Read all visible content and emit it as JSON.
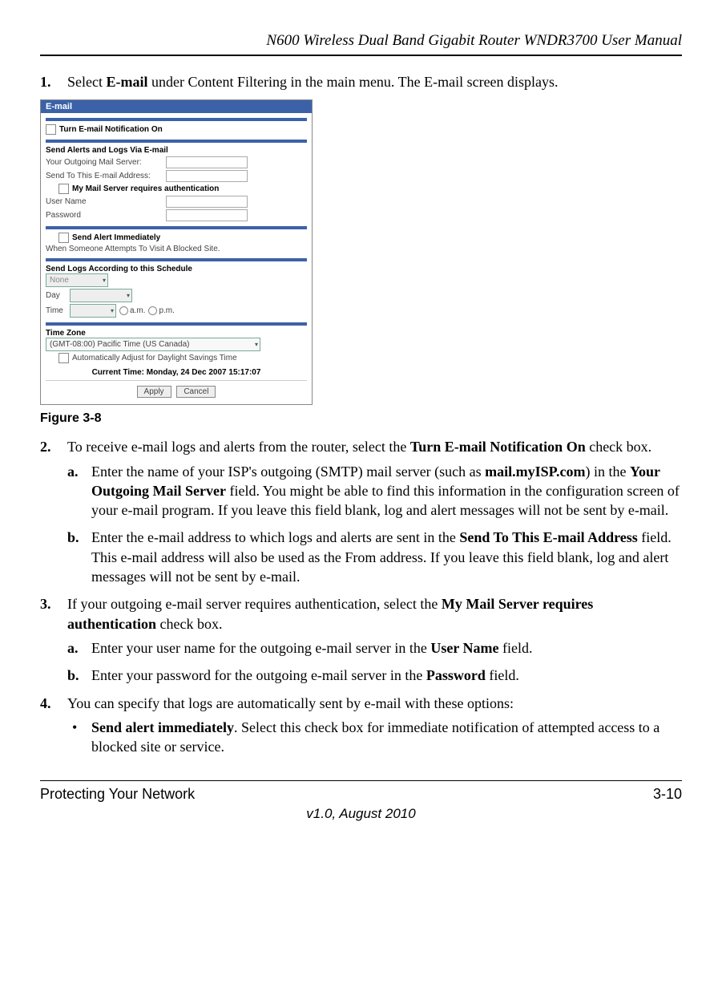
{
  "header": {
    "title": "N600 Wireless Dual Band Gigabit Router WNDR3700 User Manual"
  },
  "steps": {
    "s1": {
      "num": "1.",
      "pre": "Select ",
      "b1": "E-mail",
      "post": " under Content Filtering in the main menu. The E-mail screen displays."
    },
    "fig_caption": "Figure 3-8",
    "s2": {
      "num": "2.",
      "pre": "To receive e-mail logs and alerts from the router, select the ",
      "b1": "Turn E-mail Notification On",
      "post": " check box.",
      "a": {
        "num": "a.",
        "t1": "Enter the name of your ISP's outgoing (SMTP) mail server (such as ",
        "b1": "mail.myISP.com",
        "t2": ") in the ",
        "b2": "Your Outgoing Mail Server",
        "t3": " field. You might be able to find this information in the configuration screen of your e-mail program. If you leave this field blank, log and alert messages will not be sent by e-mail."
      },
      "b": {
        "num": "b.",
        "t1": "Enter the e-mail address to which logs and alerts are sent in the ",
        "b1": "Send To This E-mail Address",
        "t2": " field. This e-mail address will also be used as the From address. If you leave this field blank, log and alert messages will not be sent by e-mail."
      }
    },
    "s3": {
      "num": "3.",
      "t1": "If your outgoing e-mail server requires authentication, select the ",
      "b1": "My Mail Server requires authentication",
      "t2": " check box.",
      "a": {
        "num": "a.",
        "t1": "Enter your user name for the outgoing e-mail server in the ",
        "b1": "User Name",
        "t2": " field."
      },
      "b": {
        "num": "b.",
        "t1": "Enter your password for the outgoing e-mail server in the ",
        "b1": "Password",
        "t2": " field."
      }
    },
    "s4": {
      "num": "4.",
      "text": "You can specify that logs are automatically sent by e-mail with these options:",
      "bul1": {
        "b1": "Send alert immediately",
        "t1": ". Select this check box for immediate notification of attempted access to a blocked site or service."
      }
    }
  },
  "screenshot": {
    "title": "E-mail",
    "notif_label": "Turn E-mail Notification On",
    "sec1": "Send Alerts and Logs Via E-mail",
    "out_server_label": "Your Outgoing Mail Server:",
    "send_to_label": "Send To This E-mail Address:",
    "auth_label": "My Mail Server requires authentication",
    "user_label": "User Name",
    "pass_label": "Password",
    "sec2": "Send Alert Immediately",
    "sec2_sub": "When Someone Attempts To Visit A Blocked Site.",
    "sec3": "Send Logs According to this Schedule",
    "sched_none": "None",
    "day_label": "Day",
    "time_label": "Time",
    "am": "a.m.",
    "pm": "p.m.",
    "sec4": "Time Zone",
    "tz_value": "(GMT-08:00) Pacific Time (US Canada)",
    "dst_label": "Automatically Adjust for Daylight Savings Time",
    "cur_time_label": "Current Time:   Monday, 24 Dec 2007  15:17:07",
    "apply": "Apply",
    "cancel": "Cancel"
  },
  "footer": {
    "section": "Protecting Your Network",
    "page": "3-10",
    "version": "v1.0, August 2010"
  }
}
